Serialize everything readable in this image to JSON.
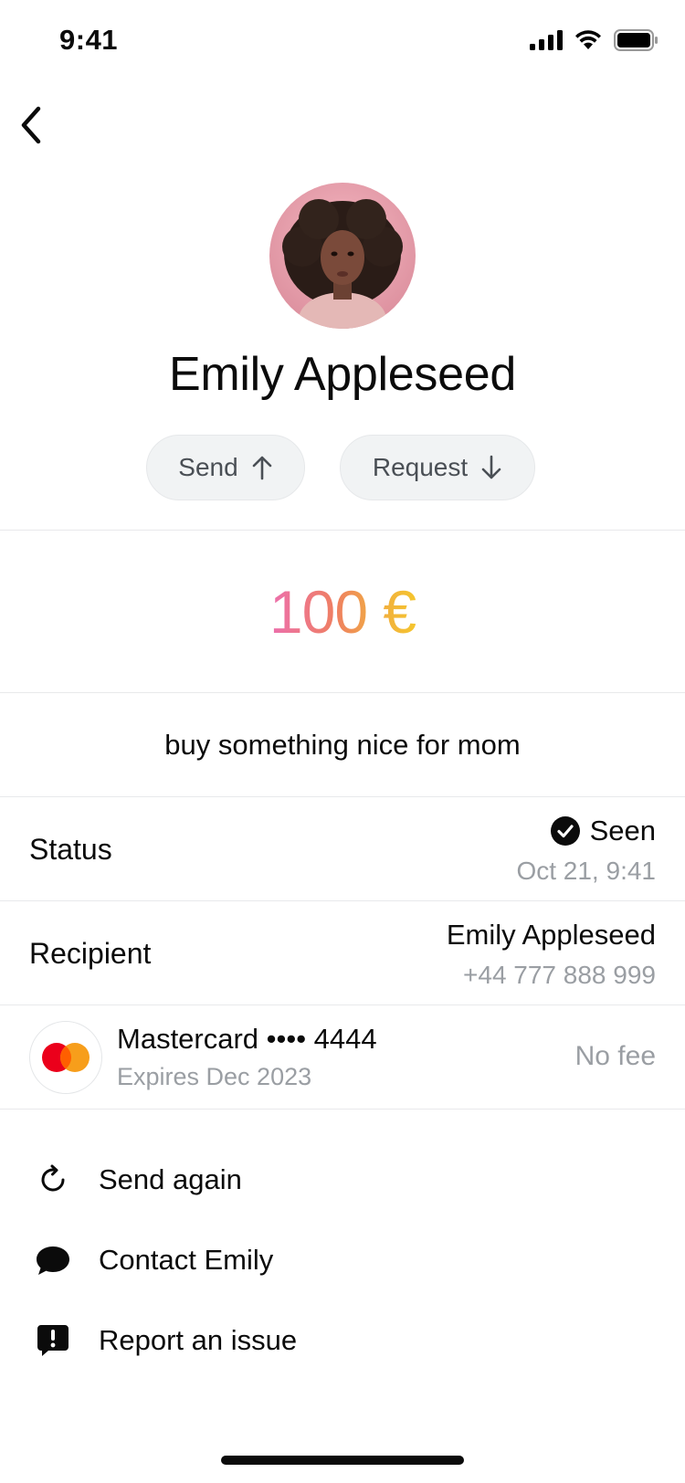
{
  "status_bar": {
    "time": "9:41"
  },
  "contact": {
    "name": "Emily Appleseed"
  },
  "actions_top": {
    "send_label": "Send",
    "request_label": "Request"
  },
  "transfer": {
    "amount": "100 €",
    "note": "buy something nice for mom"
  },
  "status": {
    "label": "Status",
    "value": "Seen",
    "timestamp": "Oct 21, 9:41"
  },
  "recipient": {
    "label": "Recipient",
    "name": "Emily Appleseed",
    "phone": "+44 777 888 999"
  },
  "payment_method": {
    "title": "Mastercard •••• 4444",
    "subtitle": "Expires Dec 2023",
    "fee": "No fee"
  },
  "actions_list": [
    {
      "label": "Send again",
      "icon": "refresh-icon"
    },
    {
      "label": "Contact Emily",
      "icon": "chat-bubble-icon"
    },
    {
      "label": "Report an issue",
      "icon": "report-icon"
    }
  ],
  "colors": {
    "amount_gradient": [
      "#ec6fae",
      "#ef7f62",
      "#f0a845",
      "#f5c52e"
    ],
    "pill_bg": "#f1f3f4",
    "secondary_text": "#9a9ea3"
  }
}
